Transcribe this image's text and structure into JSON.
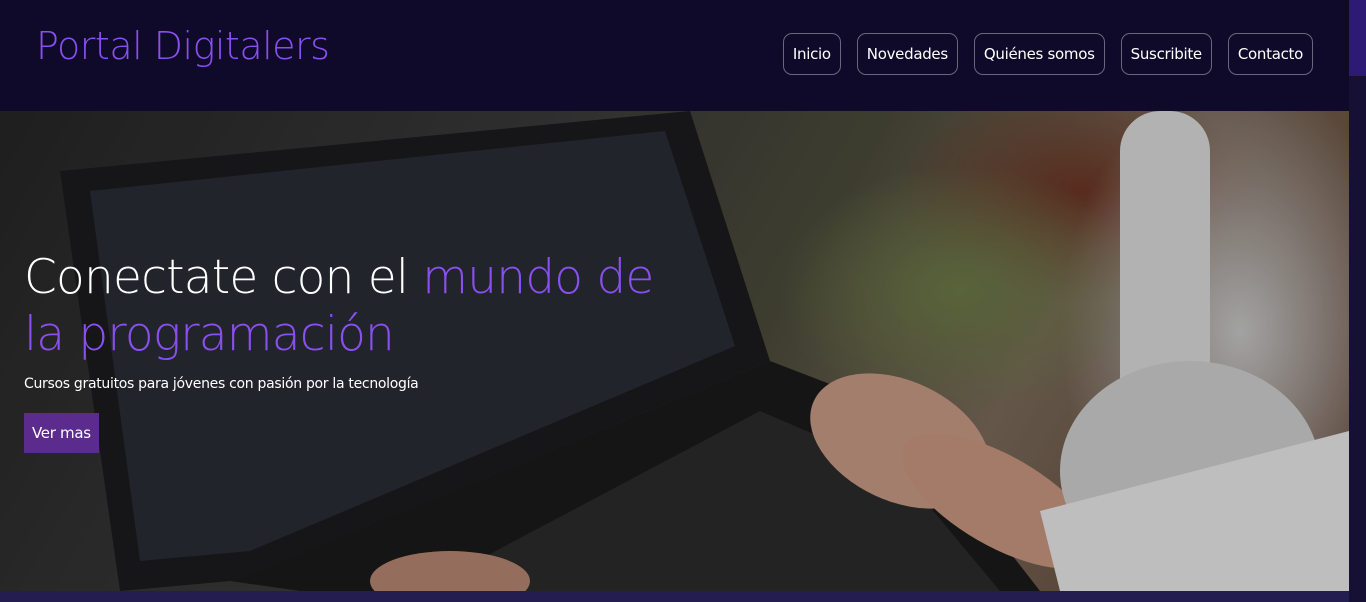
{
  "header": {
    "brand": "Portal Digitalers",
    "nav": [
      {
        "label": "Inicio"
      },
      {
        "label": "Novedades"
      },
      {
        "label": "Quiénes somos"
      },
      {
        "label": "Suscribite"
      },
      {
        "label": "Contacto"
      }
    ]
  },
  "hero": {
    "title_prefix": "Conectate con el ",
    "title_accent": "mundo de la programación",
    "subtitle": "Cursos gratuitos para jóvenes con pasión por la tecnología",
    "cta_label": "Ver mas",
    "image_alt": "Persona con auriculares escribiendo en una laptop"
  },
  "colors": {
    "header_bg": "#0f0a2a",
    "accent": "#8a4ff0",
    "button_bg": "#5b2c8e",
    "text": "#ffffff"
  }
}
